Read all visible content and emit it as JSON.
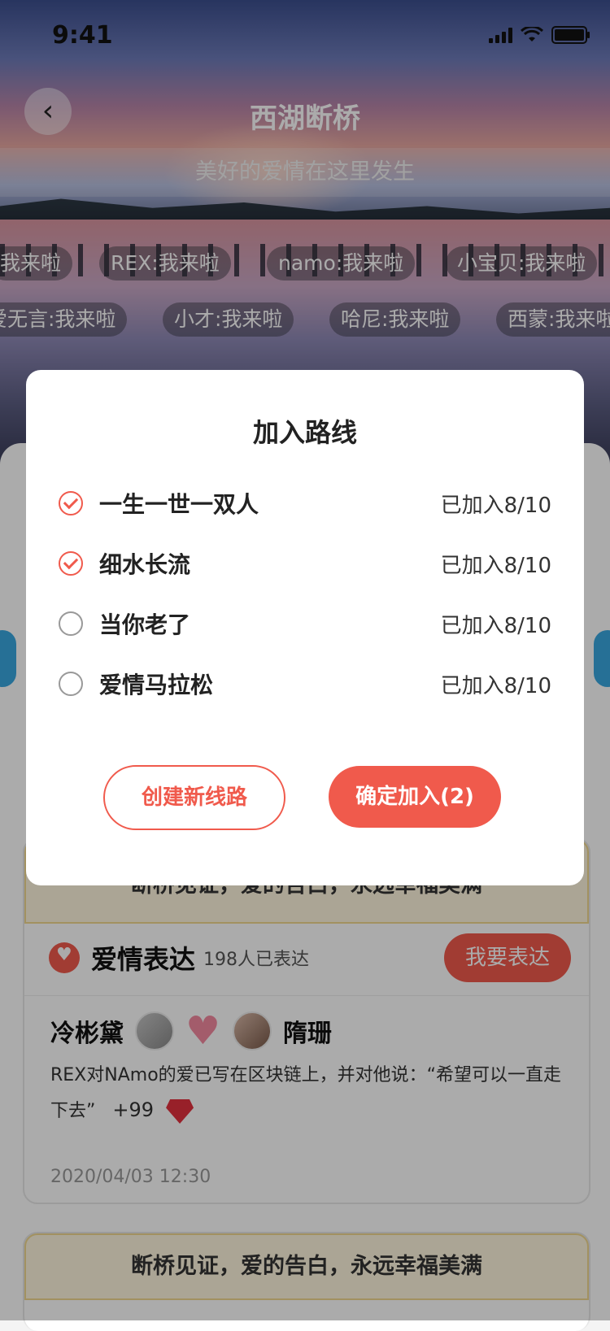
{
  "status_bar": {
    "time": "9:41"
  },
  "nav": {
    "title": "西湖断桥",
    "subtitle": "美好的爱情在这里发生"
  },
  "danmu_row1": [
    "我来啦",
    "REX:我来啦",
    "namo:我来啦",
    "小宝贝:我来啦"
  ],
  "danmu_row2": [
    "爱无言:我来啦",
    "小才:我来啦",
    "哈尼:我来啦",
    "西蒙:我来啦"
  ],
  "express_card": {
    "banner": "断桥见证，爱的告白，永远幸福美满",
    "title": "爱情表达",
    "count": "198人已表达",
    "button": "我要表达",
    "name_left": "冷彬黛",
    "name_right": "隋珊",
    "message": "REX对NAmo的爱已写在区块链上，并对他说：“希望可以一直走下去”",
    "likes": "+99",
    "date": "2020/04/03  12:30"
  },
  "second_card": {
    "banner": "断桥见证，爱的告白，永远幸福美满"
  },
  "modal": {
    "title": "加入路线",
    "routes": [
      {
        "name": "一生一世一双人",
        "status": "已加入8/10",
        "checked": true
      },
      {
        "name": "细水长流",
        "status": "已加入8/10",
        "checked": true
      },
      {
        "name": "当你老了",
        "status": "已加入8/10",
        "checked": false
      },
      {
        "name": "爱情马拉松",
        "status": "已加入8/10",
        "checked": false
      }
    ],
    "create_button": "创建新线路",
    "confirm_button": "确定加入(2)"
  },
  "colors": {
    "accent": "#f05a4c",
    "overlay": "rgba(0,0,0,0.33)",
    "banner_bg": "#fff7df"
  }
}
